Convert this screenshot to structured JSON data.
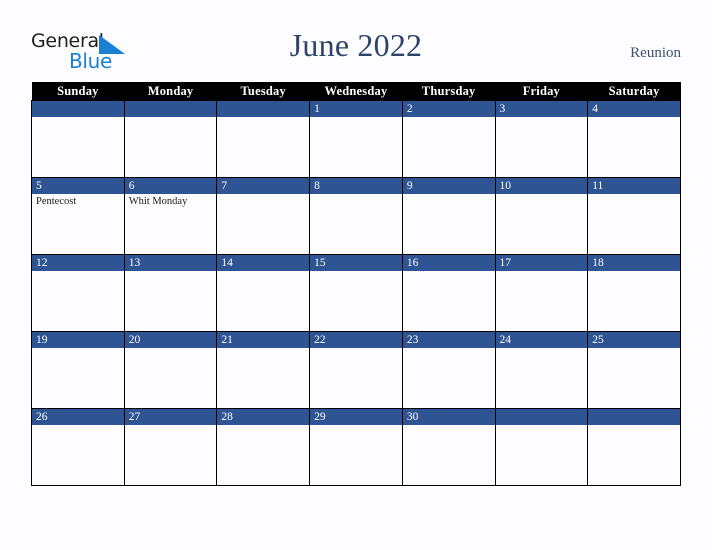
{
  "brand": {
    "line1": "General",
    "line2": "Blue",
    "mark_color": "#1b7fd4",
    "text_color": "#231f20"
  },
  "header": {
    "title": "June 2022",
    "region": "Reunion"
  },
  "colors": {
    "day_bar": "#2e5494",
    "header_row": "#000000",
    "header_text": "#ffffff",
    "title_text": "#2e4468",
    "page_background": "#fdfdff",
    "grid_border": "#000000"
  },
  "calendar": {
    "weekday_headers": [
      "Sunday",
      "Monday",
      "Tuesday",
      "Wednesday",
      "Thursday",
      "Friday",
      "Saturday"
    ],
    "weeks": [
      [
        {
          "day": "",
          "event": ""
        },
        {
          "day": "",
          "event": ""
        },
        {
          "day": "",
          "event": ""
        },
        {
          "day": "1",
          "event": ""
        },
        {
          "day": "2",
          "event": ""
        },
        {
          "day": "3",
          "event": ""
        },
        {
          "day": "4",
          "event": ""
        }
      ],
      [
        {
          "day": "5",
          "event": "Pentecost"
        },
        {
          "day": "6",
          "event": "Whit Monday"
        },
        {
          "day": "7",
          "event": ""
        },
        {
          "day": "8",
          "event": ""
        },
        {
          "day": "9",
          "event": ""
        },
        {
          "day": "10",
          "event": ""
        },
        {
          "day": "11",
          "event": ""
        }
      ],
      [
        {
          "day": "12",
          "event": ""
        },
        {
          "day": "13",
          "event": ""
        },
        {
          "day": "14",
          "event": ""
        },
        {
          "day": "15",
          "event": ""
        },
        {
          "day": "16",
          "event": ""
        },
        {
          "day": "17",
          "event": ""
        },
        {
          "day": "18",
          "event": ""
        }
      ],
      [
        {
          "day": "19",
          "event": ""
        },
        {
          "day": "20",
          "event": ""
        },
        {
          "day": "21",
          "event": ""
        },
        {
          "day": "22",
          "event": ""
        },
        {
          "day": "23",
          "event": ""
        },
        {
          "day": "24",
          "event": ""
        },
        {
          "day": "25",
          "event": ""
        }
      ],
      [
        {
          "day": "26",
          "event": ""
        },
        {
          "day": "27",
          "event": ""
        },
        {
          "day": "28",
          "event": ""
        },
        {
          "day": "29",
          "event": ""
        },
        {
          "day": "30",
          "event": ""
        },
        {
          "day": "",
          "event": ""
        },
        {
          "day": "",
          "event": ""
        }
      ]
    ]
  }
}
